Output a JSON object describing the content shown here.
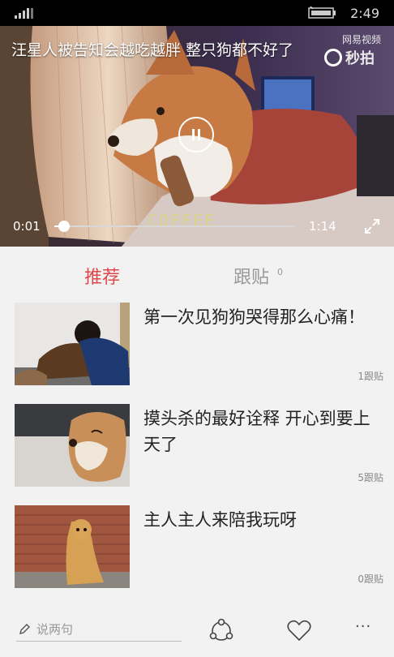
{
  "status_bar": {
    "time": "2:49"
  },
  "video": {
    "title": "汪星人被告知会越吃越胖 整只狗都不好了",
    "current_time": "0:01",
    "total_time": "1:14",
    "progress": 0.04,
    "watermark_source": "网易视频",
    "watermark_logo": "秒拍",
    "scene_text": "COFFEE"
  },
  "tabs": [
    {
      "label": "推荐",
      "active": true
    },
    {
      "label": "跟贴",
      "count": "0",
      "active": false
    }
  ],
  "items": [
    {
      "title": "第一次见狗狗哭得那么心痛！",
      "comments": "1跟贴"
    },
    {
      "title": "摸头杀的最好诠释 开心到要上天了",
      "comments": "5跟贴"
    },
    {
      "title": "主人主人来陪我玩呀",
      "comments": "0跟贴"
    }
  ],
  "bottom_bar": {
    "comment_placeholder": "说两句",
    "icons": [
      "pencil-icon",
      "share-icon",
      "heart-icon",
      "more-icon"
    ],
    "more_label": "···"
  },
  "colors": {
    "accent": "#e0474a"
  }
}
